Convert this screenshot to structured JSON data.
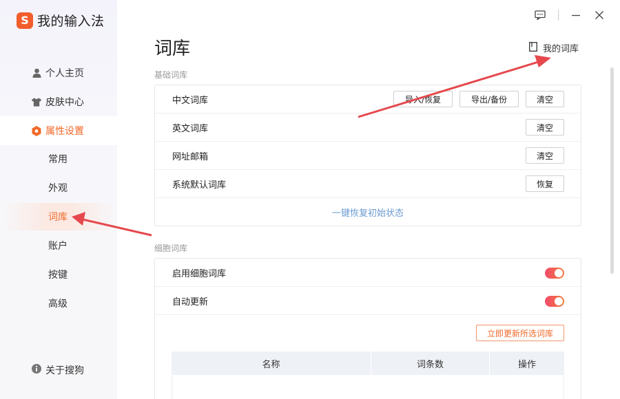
{
  "app": {
    "logo_letter": "S",
    "title": "我的输入法"
  },
  "sidebar": {
    "items": [
      {
        "label": "个人主页",
        "icon": "user-icon"
      },
      {
        "label": "皮肤中心",
        "icon": "shirt-icon"
      },
      {
        "label": "属性设置",
        "icon": "settings-hex-icon"
      }
    ],
    "sub_items": [
      {
        "label": "常用"
      },
      {
        "label": "外观"
      },
      {
        "label": "词库"
      },
      {
        "label": "账户"
      },
      {
        "label": "按键"
      },
      {
        "label": "高级"
      }
    ],
    "about": {
      "label": "关于搜狗",
      "icon": "info-icon"
    }
  },
  "header": {
    "title": "词库",
    "my_dict_label": "我的词库"
  },
  "basic": {
    "section_label": "基础词库",
    "rows": [
      {
        "label": "中文词库",
        "buttons": [
          "导入/恢复",
          "导出/备份",
          "清空"
        ]
      },
      {
        "label": "英文词库",
        "buttons": [
          "清空"
        ]
      },
      {
        "label": "网址邮箱",
        "buttons": [
          "清空"
        ]
      },
      {
        "label": "系统默认词库",
        "buttons": [
          "恢复"
        ]
      }
    ],
    "reset_link": "一键恢复初始状态"
  },
  "cell": {
    "section_label": "细胞词库",
    "rows": [
      {
        "label": "启用细胞词库",
        "toggle_on": true
      },
      {
        "label": "自动更新",
        "toggle_on": true
      }
    ],
    "update_button": "立即更新所选词库",
    "table_headers": [
      "名称",
      "词条数",
      "操作"
    ]
  },
  "colors": {
    "accent": "#f06a2a",
    "arrow": "#e5484d",
    "link": "#6a9bd1"
  }
}
